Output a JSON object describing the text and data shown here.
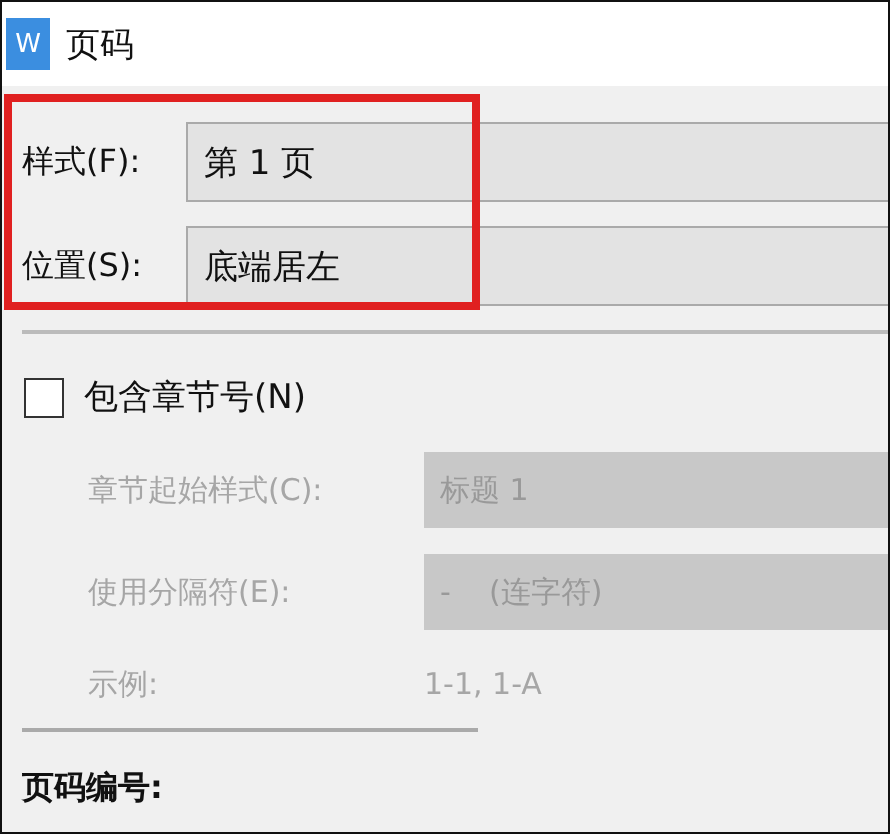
{
  "window": {
    "icon_letter": "W",
    "title": "页码"
  },
  "fields": [
    {
      "label": "样式(F):",
      "value": "第 1 页",
      "disabled": false
    },
    {
      "label": "位置(S):",
      "value": "底端居左",
      "disabled": false
    }
  ],
  "highlight": {
    "color": "#e02020"
  },
  "include_chapter": {
    "label": "包含章节号(N)",
    "checked": false
  },
  "chapter_fields": [
    {
      "label": "章节起始样式(C):",
      "value": "标题 1",
      "disabled": true
    },
    {
      "label": "使用分隔符(E):",
      "value": "-    (连字符)",
      "disabled": true
    }
  ],
  "example": {
    "label": "示例:",
    "value": "1-1, 1-A",
    "disabled": true
  },
  "section_heading": "页码编号:"
}
